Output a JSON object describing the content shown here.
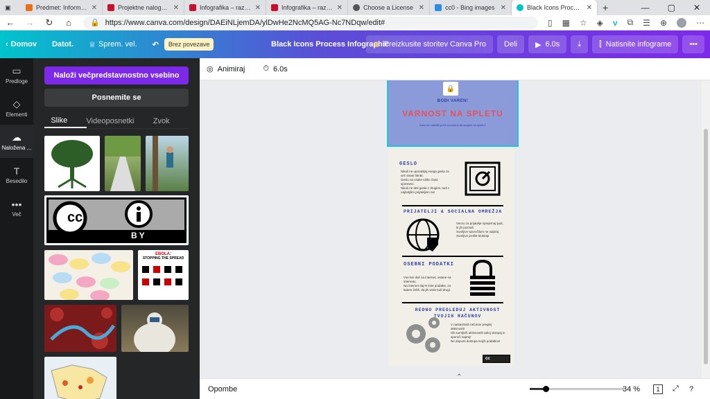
{
  "browser": {
    "tabs": [
      {
        "title": "Predmet: Informacijsk",
        "color": "#e8711a"
      },
      {
        "title": "Projektne naloge – Š",
        "color": "#c8102e"
      },
      {
        "title": "Infografika – razredni",
        "color": "#c8102e"
      },
      {
        "title": "Infografika – razredni",
        "color": "#c8102e"
      },
      {
        "title": "Choose a License",
        "color": "#555555"
      },
      {
        "title": "cc0 - Bing images",
        "color": "#2b8ee6"
      },
      {
        "title": "Black Icons Process In",
        "color": "#00c4cc"
      }
    ],
    "new_tab": "+",
    "url": "https://www.canva.com/design/DAEiNLjemDA/ylDwHe2NcMQ5AG-Nc7NDqw/edit#"
  },
  "topbar": {
    "home": "Domov",
    "file": "Datot.",
    "saved": "Sprem. vel.",
    "nosync": "Brez povezave",
    "title": "Black Icons Process Infographic",
    "pro": "Preizkusite storitev Canva Pro",
    "share": "Deli",
    "play": "6.0s",
    "print": "Natisnite infograme",
    "more": "•••"
  },
  "rail": [
    {
      "label": "Predloge",
      "icon": "▭"
    },
    {
      "label": "Elementi",
      "icon": "◇"
    },
    {
      "label": "Naložena ...",
      "icon": "☁"
    },
    {
      "label": "Besedilo",
      "icon": "T"
    },
    {
      "label": "Več",
      "icon": "•••"
    }
  ],
  "panel": {
    "upload_button": "Naloži večpredstavnostno vsebino",
    "record_button": "Posnemite se",
    "tabs": [
      "Slike",
      "Videoposnetki",
      "Zvok"
    ],
    "ebola_title": "EBOLA:",
    "ebola_sub": "STOPPING THE SPREAD",
    "cc_by": "BY"
  },
  "editor": {
    "animate": "Animiraj",
    "duration": "6.0s"
  },
  "infographic": {
    "kicker": "BODI VAREN!",
    "title": "VARNOST NA SPLETU",
    "subtitle": "Kako se zaščititi pred nevarnimi situacijami na spletu?",
    "s1_title": "GESLO",
    "s1_points": [
      "Nikoli ne uporabljaj enega gesla za več strani hkrati.",
      "Geslo na vsake toliko časa spremeni.",
      "Nikoli ne deli gesla z drugimi, tudi z najboljšim prijateljem ne!"
    ],
    "s2_title": "PRIJATELJI & SOCIALNA OMREŽJA",
    "s2_points": [
      "Vecno za prijatelje sprejemaj ljudi, ki jih poznaš.",
      "Sumljive sporočilom ne odpiraj.",
      "Sumljive profile blokiraj!"
    ],
    "s3_title": "OSEBNI PODATKI",
    "s3_points": [
      "Vse kar daš na internet, ostane na internetu.",
      "Na internet daj le tiste podatke, za katere želiš, da jih vedo tudi drugi."
    ],
    "s4_title": "REDNO PREGLEDUJ AKTIVNOST TVOJIH RAČUNOV",
    "s4_points": [
      "V nastavitvah računov preglej aktivnosti!",
      "Ob sumljivih aktivnostih takoj ukrepaj in sporoči naprej!",
      "Ne dopusti dostopa tvojih podatkov!"
    ],
    "cc_label": "cc"
  },
  "footer": {
    "notes": "Opombe",
    "zoom": "34 %",
    "page": "1",
    "zoom_level": 0.34
  }
}
